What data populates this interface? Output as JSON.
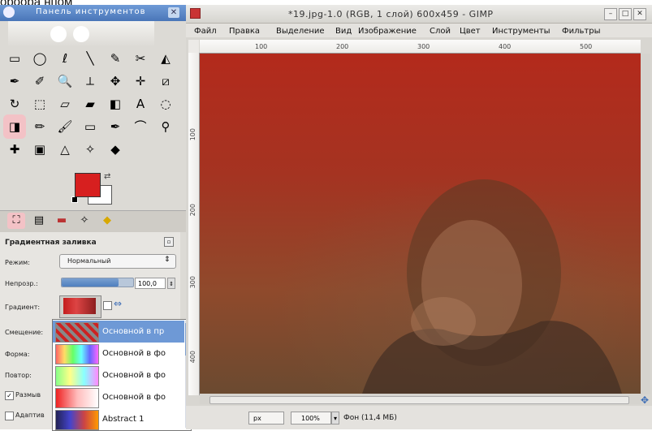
{
  "top_caption": "ороора нпом",
  "toolbox": {
    "title": "Панель инструментов",
    "close_label": "✕",
    "tools": [
      "rect-select",
      "ellipse-select",
      "free-select",
      "fuzzy-select",
      "color-select",
      "scissors",
      "foreground-select",
      "paths",
      "color-picker",
      "zoom",
      "measure",
      "move",
      "align",
      "crop",
      "rotate",
      "scale",
      "shear",
      "perspective",
      "flip",
      "text",
      "cage",
      "blend",
      "pencil",
      "paintbrush",
      "eraser",
      "airbrush",
      "ink",
      "clone",
      "heal",
      "perspective-clone",
      "blur",
      "smudge",
      "dodge"
    ],
    "tool_icons": [
      "▭",
      "◯",
      "ℓ",
      "╲",
      "✎",
      "✂",
      "◭",
      "✒",
      "✐",
      "🔍",
      "⟂",
      "✥",
      "✛",
      "⧄",
      "↻",
      "⬚",
      "▱",
      "▰",
      "◧",
      "A",
      "◌",
      "◨",
      "✏",
      "🖌",
      "▭",
      "✒",
      "⌒",
      "⚲",
      "✚",
      "▣",
      "△",
      "✧",
      "◆"
    ],
    "fg_color": "#d71f1f",
    "bg_color": "#ffffff"
  },
  "options": {
    "title": "Градиентная заливка",
    "mode_label": "Режим:",
    "mode_value": "Нормальный",
    "opacity_label": "Непрозр.:",
    "opacity_value": "100,0",
    "gradient_label": "Градиент:",
    "offset_label": "Смещение:",
    "shape_label": "Форма:",
    "repeat_label": "Повтор:",
    "dither_label": "Размыв",
    "adaptive_label": "Адаптив"
  },
  "gradient_popup": {
    "items": [
      {
        "label": "Основной в пр",
        "selected": true
      },
      {
        "label": "Основной в фо",
        "selected": false
      },
      {
        "label": "Основной в фо",
        "selected": false
      },
      {
        "label": "Основной в фо",
        "selected": false
      },
      {
        "label": "Abstract 1",
        "selected": false
      }
    ]
  },
  "image_window": {
    "title": "*19.jpg-1.0 (RGB, 1 слой) 600x459 - GIMP",
    "menu": [
      "Файл",
      "Правка",
      "Выделение",
      "Вид",
      "Изображение",
      "Слой",
      "Цвет",
      "Инструменты",
      "Фильтры"
    ],
    "ruler_top": [
      "100",
      "200",
      "300",
      "400",
      "500"
    ],
    "ruler_left": [
      "100",
      "200",
      "300",
      "400"
    ],
    "unit": "px",
    "zoom": "100%",
    "status": "Фон (11,4 МБ)"
  }
}
